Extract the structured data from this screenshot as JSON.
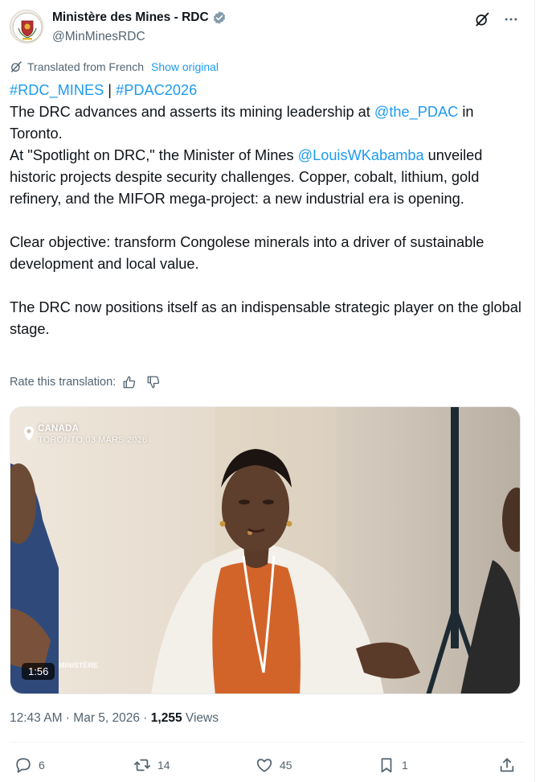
{
  "author": {
    "name": "Ministère des Mines - RDC",
    "handle": "@MinMinesRDC",
    "verified_color": "#829aab"
  },
  "translation": {
    "label": "Translated from French",
    "show_original": "Show original",
    "rate_label": "Rate this translation:"
  },
  "tweet": {
    "hashtag1": "#RDC_MINES",
    "separator": " | ",
    "hashtag2": "#PDAC2026",
    "p1_a": "The DRC advances and asserts its mining leadership at ",
    "mention1": "@the_PDAC",
    "p1_b": " in Toronto.",
    "p2_a": "At \"Spotlight on DRC,\" the Minister of Mines ",
    "mention2": "@LouisWKabamba",
    "p2_b": " unveiled historic projects despite security challenges. Copper, cobalt, lithium, gold refinery, and the MIFOR mega-project: a new industrial era is opening.",
    "p3": "Clear objective: transform Congolese minerals into a driver of sustainable development and local value.",
    "p4": "The DRC now positions itself as an indispensable strategic player on the global stage."
  },
  "media": {
    "location": "CANADA",
    "location_sub": "TORONTO 03 MARS 2026",
    "duration": "1:56",
    "watermark": "MINISTÈRE"
  },
  "meta": {
    "time": "12:43 AM",
    "dot": " · ",
    "date": "Mar 5, 2026",
    "views_count": "1,255",
    "views_label": " Views"
  },
  "actions": {
    "replies": "6",
    "reposts": "14",
    "likes": "45",
    "bookmarks": "1"
  },
  "colors": {
    "link": "#1d9bf0",
    "secondary_text": "#536471",
    "primary_text": "#0f1419"
  }
}
